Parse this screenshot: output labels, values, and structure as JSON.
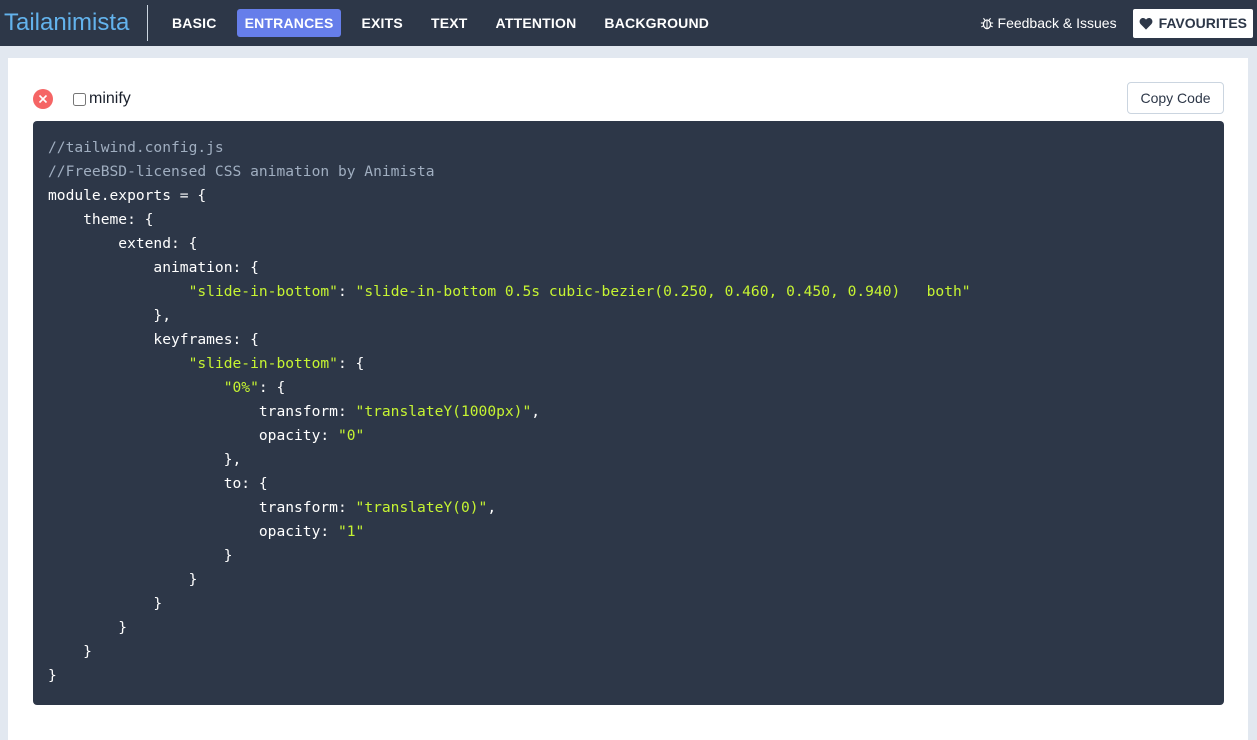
{
  "header": {
    "brand": "Tailanimista",
    "nav": [
      {
        "label": "BASIC",
        "active": false
      },
      {
        "label": "ENTRANCES",
        "active": true
      },
      {
        "label": "EXITS",
        "active": false
      },
      {
        "label": "TEXT",
        "active": false
      },
      {
        "label": "ATTENTION",
        "active": false
      },
      {
        "label": "BACKGROUND",
        "active": false
      }
    ],
    "feedback_label": "Feedback & Issues",
    "favourites_label": "FAVOURITES"
  },
  "toolbar": {
    "minify_label": "minify",
    "minify_checked": false,
    "copy_label": "Copy Code"
  },
  "code": {
    "lines": [
      [
        {
          "t": "//tailwind.config.js",
          "k": "comment"
        }
      ],
      [
        {
          "t": "//FreeBSD-licensed CSS animation by Animista",
          "k": "comment"
        }
      ],
      [
        {
          "t": "module.exports = {",
          "k": "plain"
        }
      ],
      [
        {
          "t": "    theme: {",
          "k": "plain"
        }
      ],
      [
        {
          "t": "        extend: {",
          "k": "plain"
        }
      ],
      [
        {
          "t": "            animation: {",
          "k": "plain"
        }
      ],
      [
        {
          "t": "                ",
          "k": "plain"
        },
        {
          "t": "\"slide-in-bottom\"",
          "k": "string"
        },
        {
          "t": ": ",
          "k": "plain"
        },
        {
          "t": "\"slide-in-bottom 0.5s cubic-bezier(0.250, 0.460, 0.450, 0.940)   both\"",
          "k": "string"
        }
      ],
      [
        {
          "t": "            },",
          "k": "plain"
        }
      ],
      [
        {
          "t": "            keyframes: {",
          "k": "plain"
        }
      ],
      [
        {
          "t": "                ",
          "k": "plain"
        },
        {
          "t": "\"slide-in-bottom\"",
          "k": "string"
        },
        {
          "t": ": {",
          "k": "plain"
        }
      ],
      [
        {
          "t": "                    ",
          "k": "plain"
        },
        {
          "t": "\"0%\"",
          "k": "string"
        },
        {
          "t": ": {",
          "k": "plain"
        }
      ],
      [
        {
          "t": "                        transform: ",
          "k": "plain"
        },
        {
          "t": "\"translateY(1000px)\"",
          "k": "string"
        },
        {
          "t": ",",
          "k": "plain"
        }
      ],
      [
        {
          "t": "                        opacity: ",
          "k": "plain"
        },
        {
          "t": "\"0\"",
          "k": "string"
        }
      ],
      [
        {
          "t": "                    },",
          "k": "plain"
        }
      ],
      [
        {
          "t": "                    to: {",
          "k": "plain"
        }
      ],
      [
        {
          "t": "                        transform: ",
          "k": "plain"
        },
        {
          "t": "\"translateY(0)\"",
          "k": "string"
        },
        {
          "t": ",",
          "k": "plain"
        }
      ],
      [
        {
          "t": "                        opacity: ",
          "k": "plain"
        },
        {
          "t": "\"1\"",
          "k": "string"
        }
      ],
      [
        {
          "t": "                    }",
          "k": "plain"
        }
      ],
      [
        {
          "t": "                }",
          "k": "plain"
        }
      ],
      [
        {
          "t": "            }",
          "k": "plain"
        }
      ],
      [
        {
          "t": "        }",
          "k": "plain"
        }
      ],
      [
        {
          "t": "    }",
          "k": "plain"
        }
      ],
      [
        {
          "t": "}",
          "k": "plain"
        }
      ]
    ]
  },
  "colors": {
    "topbar": "#2d3748",
    "brand": "#63b3ed",
    "active_tab": "#667eea",
    "code_bg": "#2d3748",
    "code_string": "#c6f432",
    "code_comment": "#a0aec0",
    "close": "#f56565"
  },
  "icons": {
    "feedback": "bug-icon",
    "favourites": "heart-icon",
    "close": "close-icon"
  }
}
